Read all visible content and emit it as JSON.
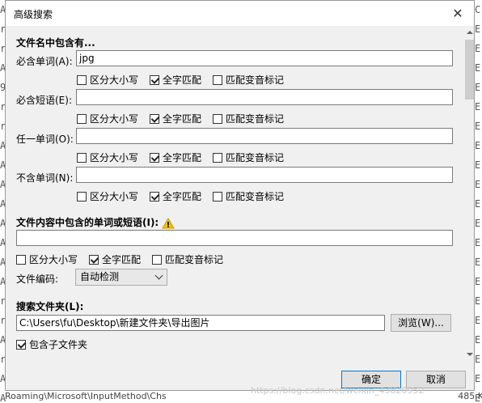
{
  "background": {
    "left_column": [
      "A",
      "r",
      "r",
      "A",
      "9",
      "r",
      "r",
      "A",
      "A",
      "A",
      "A",
      "A",
      "A",
      "A",
      "A",
      "r",
      "r",
      "A",
      "r",
      "A",
      "A"
    ],
    "right_column": [
      "C",
      "E",
      "E",
      "E",
      "E",
      "E",
      "E",
      "E",
      "E",
      "E",
      "E",
      "E",
      "E",
      "E",
      "E",
      "E",
      "E",
      "E",
      "E",
      "E",
      "E"
    ],
    "bottom_strip": "Roaming\\Microsoft\\InputMethod\\Chs",
    "bottom_right": "485 K"
  },
  "dialog": {
    "title": "高级搜索",
    "close_glyph": "✕",
    "filename_section": {
      "heading": "文件名中包含有...",
      "rows": [
        {
          "label": "必含单词(A):",
          "value": "jpg",
          "options": [
            {
              "label": "区分大小写",
              "checked": false
            },
            {
              "label": "全字匹配",
              "checked": true
            },
            {
              "label": "匹配变音标记",
              "checked": false
            }
          ]
        },
        {
          "label": "必含短语(E):",
          "value": "",
          "options": [
            {
              "label": "区分大小写",
              "checked": false
            },
            {
              "label": "全字匹配",
              "checked": true
            },
            {
              "label": "匹配变音标记",
              "checked": false
            }
          ]
        },
        {
          "label": "任一单词(O):",
          "value": "",
          "options": [
            {
              "label": "区分大小写",
              "checked": false
            },
            {
              "label": "全字匹配",
              "checked": true
            },
            {
              "label": "匹配变音标记",
              "checked": false
            }
          ]
        },
        {
          "label": "不含单词(N):",
          "value": "",
          "options": [
            {
              "label": "区分大小写",
              "checked": false
            },
            {
              "label": "全字匹配",
              "checked": true
            },
            {
              "label": "匹配变音标记",
              "checked": false
            }
          ]
        }
      ]
    },
    "content_section": {
      "heading": "文件内容中包含的单词或短语(I):",
      "value": "",
      "options": [
        {
          "label": "区分大小写",
          "checked": false
        },
        {
          "label": "全字匹配",
          "checked": true
        },
        {
          "label": "匹配变音标记",
          "checked": false
        }
      ],
      "encoding_label": "文件编码:",
      "encoding_value": "自动检测"
    },
    "folder_section": {
      "heading": "搜索文件夹(L):",
      "path": "C:\\Users\\fu\\Desktop\\新建文件夹\\导出图片",
      "browse_label": "浏览(W)...",
      "subfolders_label": "包含子文件夹",
      "subfolders_checked": true
    },
    "footer": {
      "ok_label": "确定",
      "cancel_label": "取消"
    },
    "watermark": "https://blog.csdn.net/weixin_43820952"
  }
}
